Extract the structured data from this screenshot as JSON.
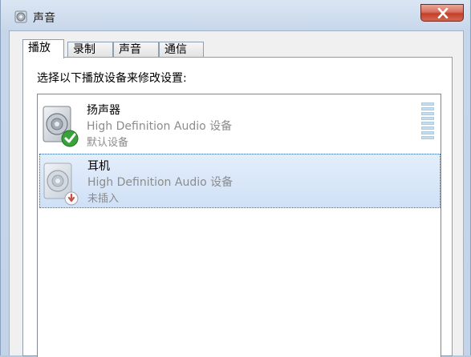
{
  "window": {
    "title": "声音"
  },
  "tabs": [
    {
      "label": "播放",
      "active": true
    },
    {
      "label": "录制",
      "active": false
    },
    {
      "label": "声音",
      "active": false
    },
    {
      "label": "通信",
      "active": false
    }
  ],
  "panel": {
    "instruction": "选择以下播放设备来修改设置:"
  },
  "devices": [
    {
      "name": "扬声器",
      "description": "High Definition Audio 设备",
      "status": "默认设备",
      "icon": "speaker-default-icon",
      "selected": false
    },
    {
      "name": "耳机",
      "description": "High Definition Audio 设备",
      "status": "未插入",
      "icon": "speaker-unplugged-icon",
      "selected": true
    }
  ],
  "colors": {
    "selection": "#cfe0f6",
    "default_check": "#3aa23a",
    "unplugged_badge": "#c0392b"
  }
}
